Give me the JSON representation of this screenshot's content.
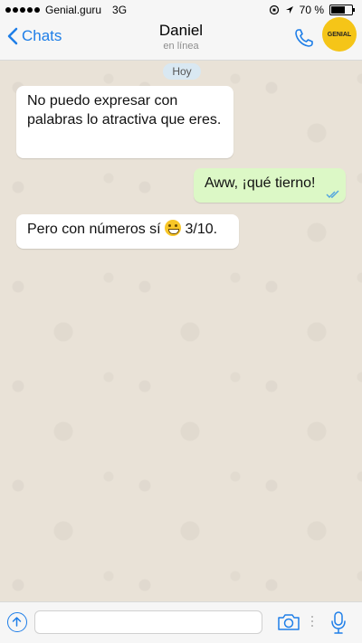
{
  "status_bar": {
    "carrier": "Genial.guru",
    "network": "3G",
    "battery": "70 %",
    "battery_level": 0.7
  },
  "nav": {
    "back_label": "Chats",
    "contact_name": "Daniel",
    "contact_status": "en línea",
    "badge_text": "GENIAL"
  },
  "chat": {
    "date_label": "Hoy",
    "messages": [
      {
        "direction": "incoming",
        "text": "No puedo expresar con palabras lo atractiva que eres."
      },
      {
        "direction": "outgoing",
        "text": "Aww, ¡qué tierno!",
        "read": true
      },
      {
        "direction": "incoming",
        "text_before": "Pero con números sí",
        "emoji": "grinning-face",
        "text_after": "3/10."
      }
    ]
  },
  "input": {
    "placeholder": ""
  },
  "colors": {
    "accent": "#1e7ee8",
    "outgoing_bubble": "#dcf8c6",
    "incoming_bubble": "#ffffff",
    "badge": "#f5c518"
  }
}
